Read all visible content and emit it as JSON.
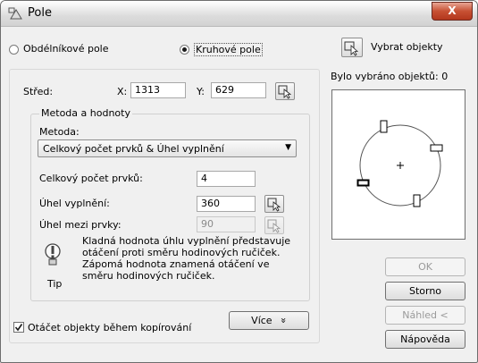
{
  "window": {
    "title": "Pole",
    "close_glyph": "X"
  },
  "type_radio": {
    "rect_label": "Obdélníkové pole",
    "polar_label": "Kruhové pole",
    "selected": "polar"
  },
  "select_objects": {
    "label": "Vybrat objekty",
    "count_text": "Bylo vybráno objektů: 0"
  },
  "center": {
    "label": "Střed:",
    "x_label": "X:",
    "x_value": "1313",
    "y_label": "Y:",
    "y_value": "629"
  },
  "method_group": {
    "legend": "Metoda a hodnoty",
    "method_label": "Metoda:",
    "method_value": "Celkový počet prvků & Úhel vyplnění",
    "total_items_label": "Celkový počet prvků:",
    "total_items_value": "4",
    "fill_angle_label": "Úhel vyplnění:",
    "fill_angle_value": "360",
    "angle_between_label": "Úhel mezi prvky:",
    "angle_between_value": "90"
  },
  "tip": {
    "text": "Kladná hodnota úhlu vyplnění představuje otáčení proti směru hodinových ručiček. Zápomá hodnota znamená otáčení ve směru hodinových ručiček.",
    "caption": "Tip"
  },
  "rotate_checkbox": {
    "label": "Otáčet objekty během kopírování",
    "checked": true
  },
  "more_button": {
    "label": "Více",
    "glyph": "»"
  },
  "buttons": {
    "ok": "OK",
    "cancel": "Storno",
    "preview": "Náhled <",
    "help": "Nápověda"
  }
}
